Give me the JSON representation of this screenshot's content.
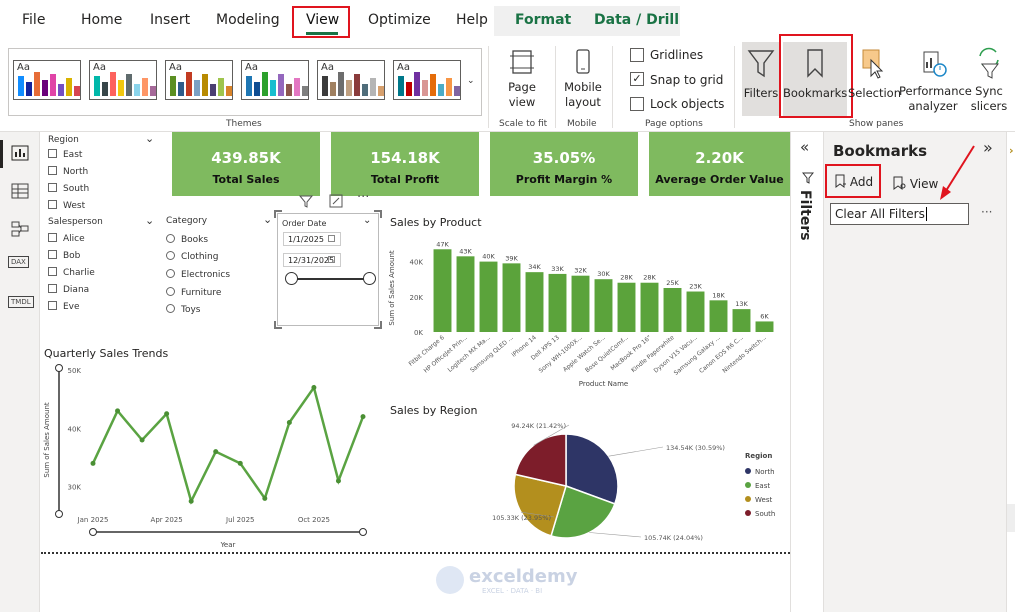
{
  "tabs": {
    "file": "File",
    "home": "Home",
    "insert": "Insert",
    "modeling": "Modeling",
    "view": "View",
    "optimize": "Optimize",
    "help": "Help",
    "format": "Format",
    "datadrill": "Data / Drill"
  },
  "ribbon": {
    "themes_label": "Themes",
    "page_view": "Page view",
    "scale_label": "Scale to fit",
    "mobile_layout": "Mobile layout",
    "mobile_label": "Mobile",
    "gridlines": "Gridlines",
    "snap": "Snap to grid",
    "lock": "Lock objects",
    "page_options": "Page options",
    "filters": "Filters",
    "bookmarks": "Bookmarks",
    "selection": "Selection",
    "performance": "Performance analyzer",
    "sync": "Sync slicers",
    "show_panes": "Show panes",
    "snap_checked": true
  },
  "cards": [
    {
      "value": "439.85K",
      "label": "Total Sales"
    },
    {
      "value": "154.18K",
      "label": "Total Profit"
    },
    {
      "value": "35.05%",
      "label": "Profit Margin %"
    },
    {
      "value": "2.20K",
      "label": "Average Order Value"
    }
  ],
  "slicers": {
    "region": {
      "title": "Region",
      "items": [
        "East",
        "North",
        "South",
        "West"
      ]
    },
    "salesperson": {
      "title": "Salesperson",
      "items": [
        "Alice",
        "Bob",
        "Charlie",
        "Diana",
        "Eve"
      ]
    },
    "category": {
      "title": "Category",
      "items": [
        "Books",
        "Clothing",
        "Electronics",
        "Furniture",
        "Toys"
      ]
    },
    "order_date": {
      "title": "Order Date",
      "start": "1/1/2025",
      "end": "12/31/2025"
    }
  },
  "left_nav": {
    "dax": "DAX",
    "tmdl": "TMDL"
  },
  "filters_pane_label": "Filters",
  "bookmarks": {
    "title": "Bookmarks",
    "add": "Add",
    "view": "View",
    "item": "Clear All Filters",
    "more": "···"
  },
  "watermark": {
    "name": "exceldemy",
    "tag": "EXCEL · DATA · BI"
  },
  "colors": {
    "accent_green": "#7fba5f",
    "bar_green": "#5ba33b",
    "line_green": "#5aa342",
    "highlight_red": "#e0141e"
  },
  "chart_data": [
    {
      "type": "bar",
      "title": "Sales by Product",
      "xlabel": "Product Name",
      "ylabel": "Sum of Sales Amount",
      "categories": [
        "Fitbit Charge 6",
        "HP OfficeJet Prin...",
        "Logitech MX Ma...",
        "Samsung QLED ...",
        "iPhone 14",
        "Dell XPS 13",
        "Sony WH-1000X...",
        "Apple Watch Se...",
        "Bose QuietComf...",
        "MacBook Pro 16\"",
        "Kindle Paperwhite",
        "Dyson V15 Vacu...",
        "Samsung Galaxy ...",
        "Canon EOS R6 C...",
        "Nintendo Switch..."
      ],
      "values": [
        47,
        43,
        40,
        39,
        34,
        33,
        32,
        30,
        28,
        28,
        25,
        23,
        18,
        13,
        6
      ],
      "labels": [
        "47K",
        "43K",
        "40K",
        "39K",
        "34K",
        "33K",
        "32K",
        "30K",
        "28K",
        "28K",
        "25K",
        "23K",
        "18K",
        "13K",
        "6K"
      ],
      "yticks": [
        "0K",
        "20K",
        "40K"
      ],
      "ylim": [
        0,
        50
      ]
    },
    {
      "type": "line",
      "title": "Quarterly Sales Trends",
      "xlabel": "Year",
      "ylabel": "Sum of Sales Amount",
      "xticks": [
        "Jan 2025",
        "Apr 2025",
        "Jul 2025",
        "Oct 2025"
      ],
      "yticks": [
        "30K",
        "40K",
        "50K"
      ],
      "ylim": [
        26,
        50
      ],
      "values": [
        34,
        43,
        38,
        42.5,
        27.5,
        36,
        34,
        28,
        41,
        47,
        31,
        42
      ]
    },
    {
      "type": "pie",
      "title": "Sales by Region",
      "legend_title": "Region",
      "series": [
        {
          "name": "North",
          "value": 30.59,
          "label": "134.54K (30.59%)",
          "color": "#2e3566"
        },
        {
          "name": "East",
          "value": 24.04,
          "label": "105.74K (24.04%)",
          "color": "#5aa342"
        },
        {
          "name": "West",
          "value": 23.95,
          "label": "105.33K (23.95%)",
          "color": "#b38f1e"
        },
        {
          "name": "South",
          "value": 21.42,
          "label": "94.24K (21.42%)",
          "color": "#7d1d2a"
        }
      ]
    }
  ]
}
